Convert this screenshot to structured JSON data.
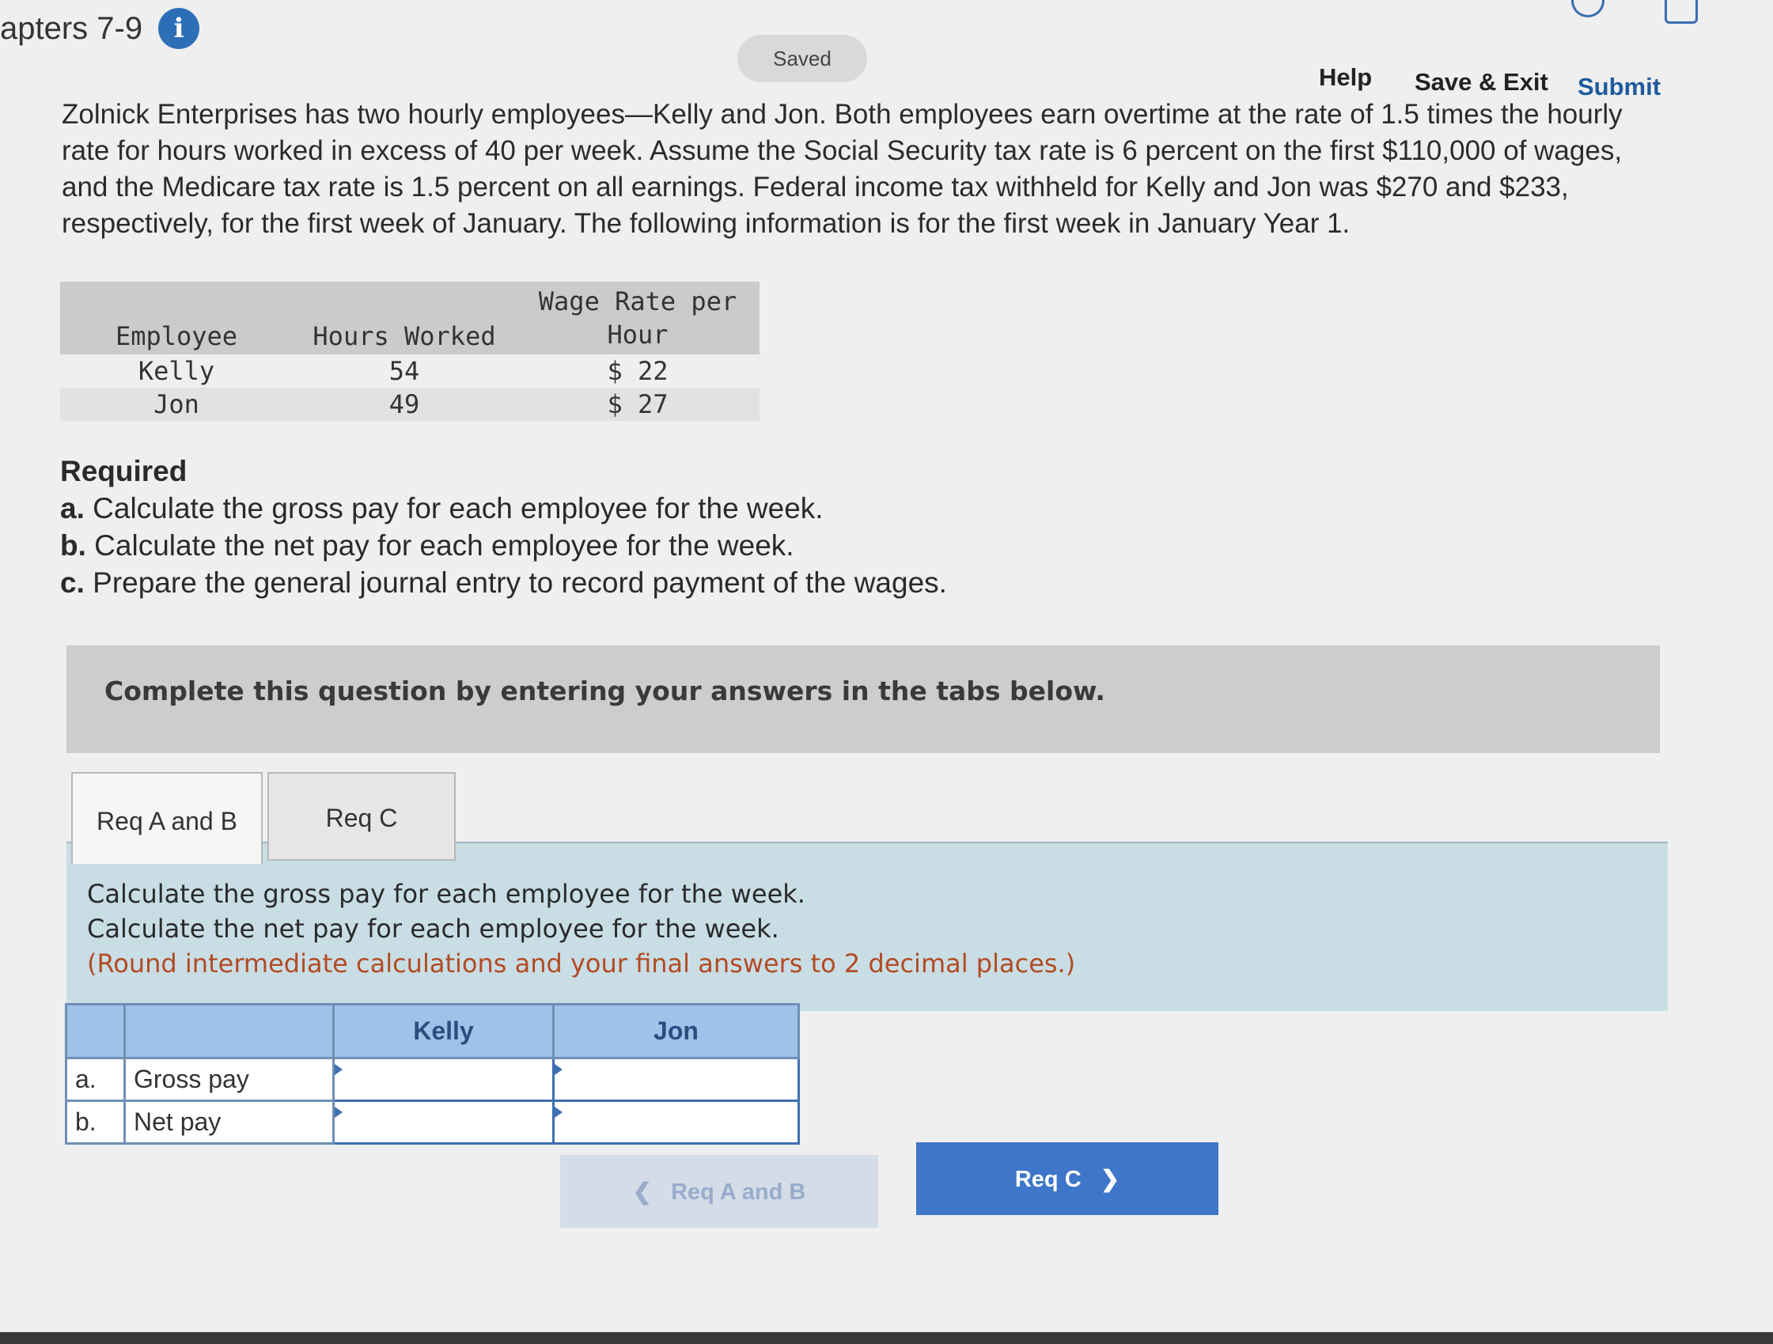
{
  "header": {
    "title": "apters 7-9",
    "info_icon": "i",
    "saved": "Saved",
    "help": "Help",
    "save_exit": "Save & Exit",
    "submit": "Submit"
  },
  "problem": {
    "text": "Zolnick Enterprises has two hourly employees—Kelly and Jon. Both employees earn overtime at the rate of 1.5 times the hourly rate for hours worked in excess of 40 per week. Assume the Social Security tax rate is 6 percent on the first $110,000 of wages, and the Medicare tax rate is 1.5 percent on all earnings. Federal income tax withheld for Kelly and Jon was $270 and $233, respectively, for the first week of January. The following information is for the first week in January Year 1."
  },
  "info_table": {
    "headers": [
      "Employee",
      "Hours Worked",
      "Wage Rate per Hour"
    ],
    "rows": [
      [
        "Kelly",
        "54",
        "$ 22"
      ],
      [
        "Jon",
        "49",
        "$ 27"
      ]
    ]
  },
  "required": {
    "heading": "Required",
    "a_label": "a.",
    "a_text": "Calculate the gross pay for each employee for the week.",
    "b_label": "b.",
    "b_text": "Calculate the net pay for each employee for the week.",
    "c_label": "c.",
    "c_text": "Prepare the general journal entry to record payment of the wages."
  },
  "complete_bar": "Complete this question by entering your answers in the tabs below.",
  "tabs": [
    "Req A and B",
    "Req C"
  ],
  "panel": {
    "line1": "Calculate the gross pay for each employee for the week.",
    "line2": "Calculate the net pay for each employee for the week.",
    "note": "(Round intermediate calculations and your final answers to 2 decimal places.)"
  },
  "answer_table": {
    "col_kelly": "Kelly",
    "col_jon": "Jon",
    "rows": [
      {
        "letter": "a.",
        "label": "Gross pay",
        "kelly": "",
        "jon": ""
      },
      {
        "letter": "b.",
        "label": "Net pay",
        "kelly": "",
        "jon": ""
      }
    ]
  },
  "nav": {
    "prev": "Req A and B",
    "next": "Req C"
  },
  "icons": [
    "info-icon",
    "refresh-icon",
    "document-icon",
    "chevron-left-icon",
    "chevron-right-icon"
  ]
}
